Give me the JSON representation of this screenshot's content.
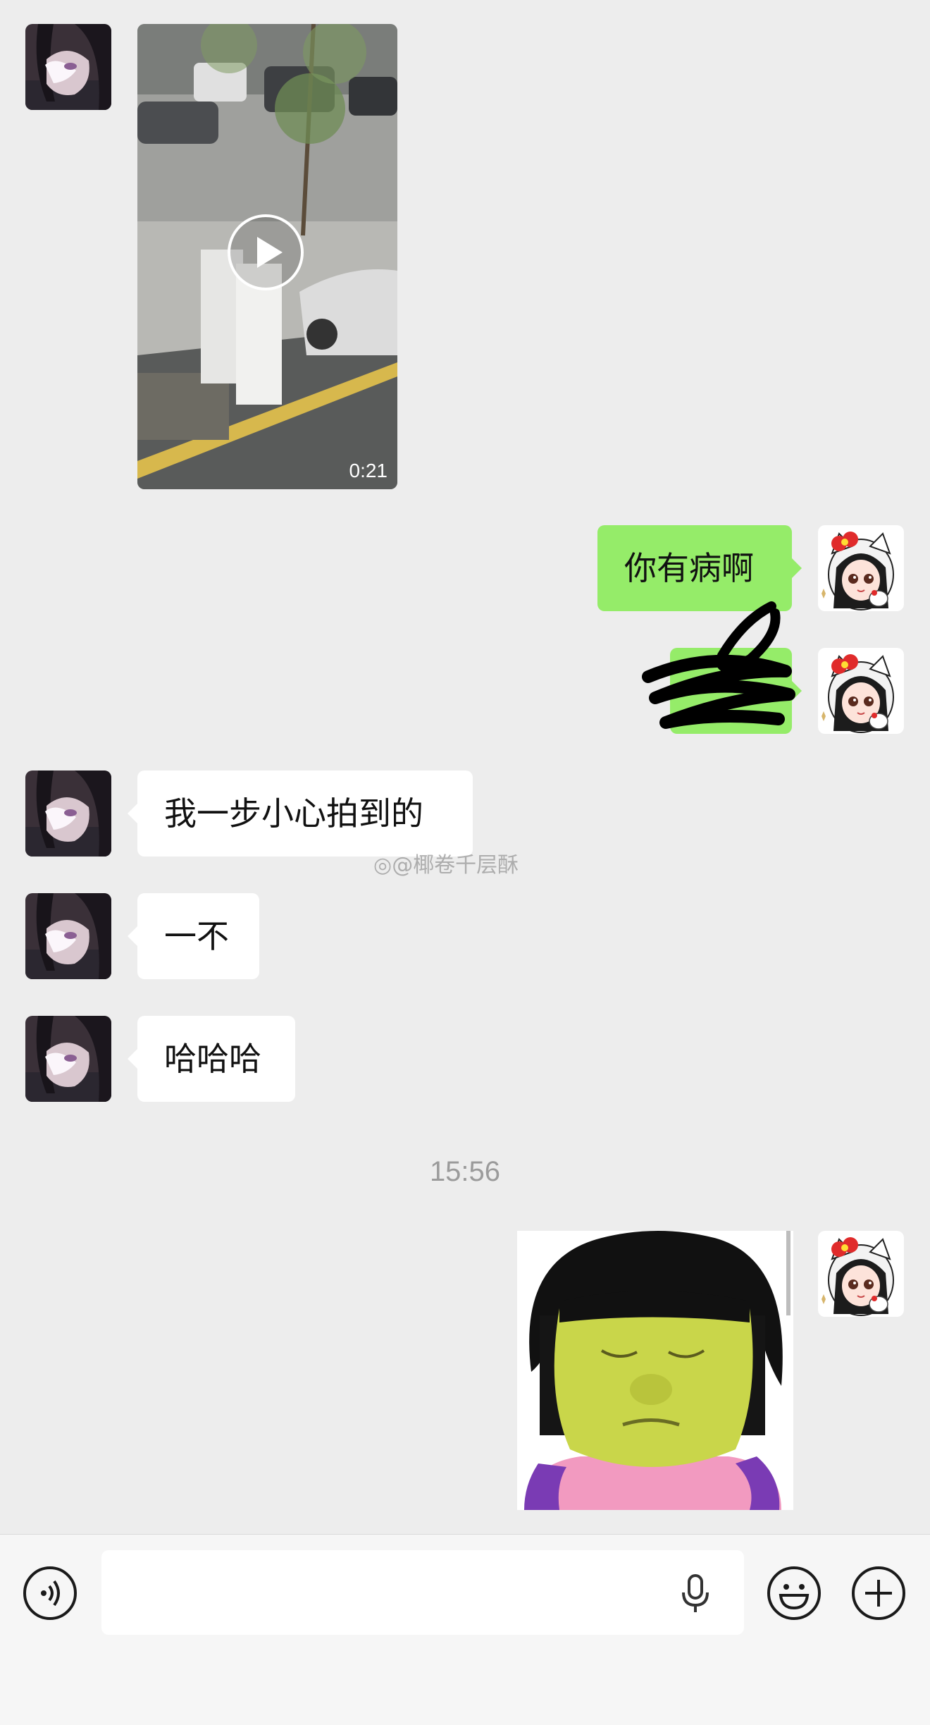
{
  "chat": {
    "video": {
      "duration": "0:21"
    },
    "messages": [
      {
        "text": "你有病啊"
      },
      {
        "text": ""
      },
      {
        "text": "我一步小心拍到的"
      },
      {
        "text": "一不"
      },
      {
        "text": "哈哈哈"
      }
    ],
    "timestamp": "15:56",
    "watermark": "@椰卷千层酥"
  },
  "input_bar": {
    "value": "",
    "voice_icon": "voice-icon",
    "mic_icon": "mic-icon",
    "emoji_icon": "emoji-icon",
    "plus_icon": "plus-icon"
  },
  "colors": {
    "background": "#ededed",
    "outgoing_bubble": "#95ec69",
    "incoming_bubble": "#ffffff",
    "input_bar": "#f6f6f6"
  }
}
